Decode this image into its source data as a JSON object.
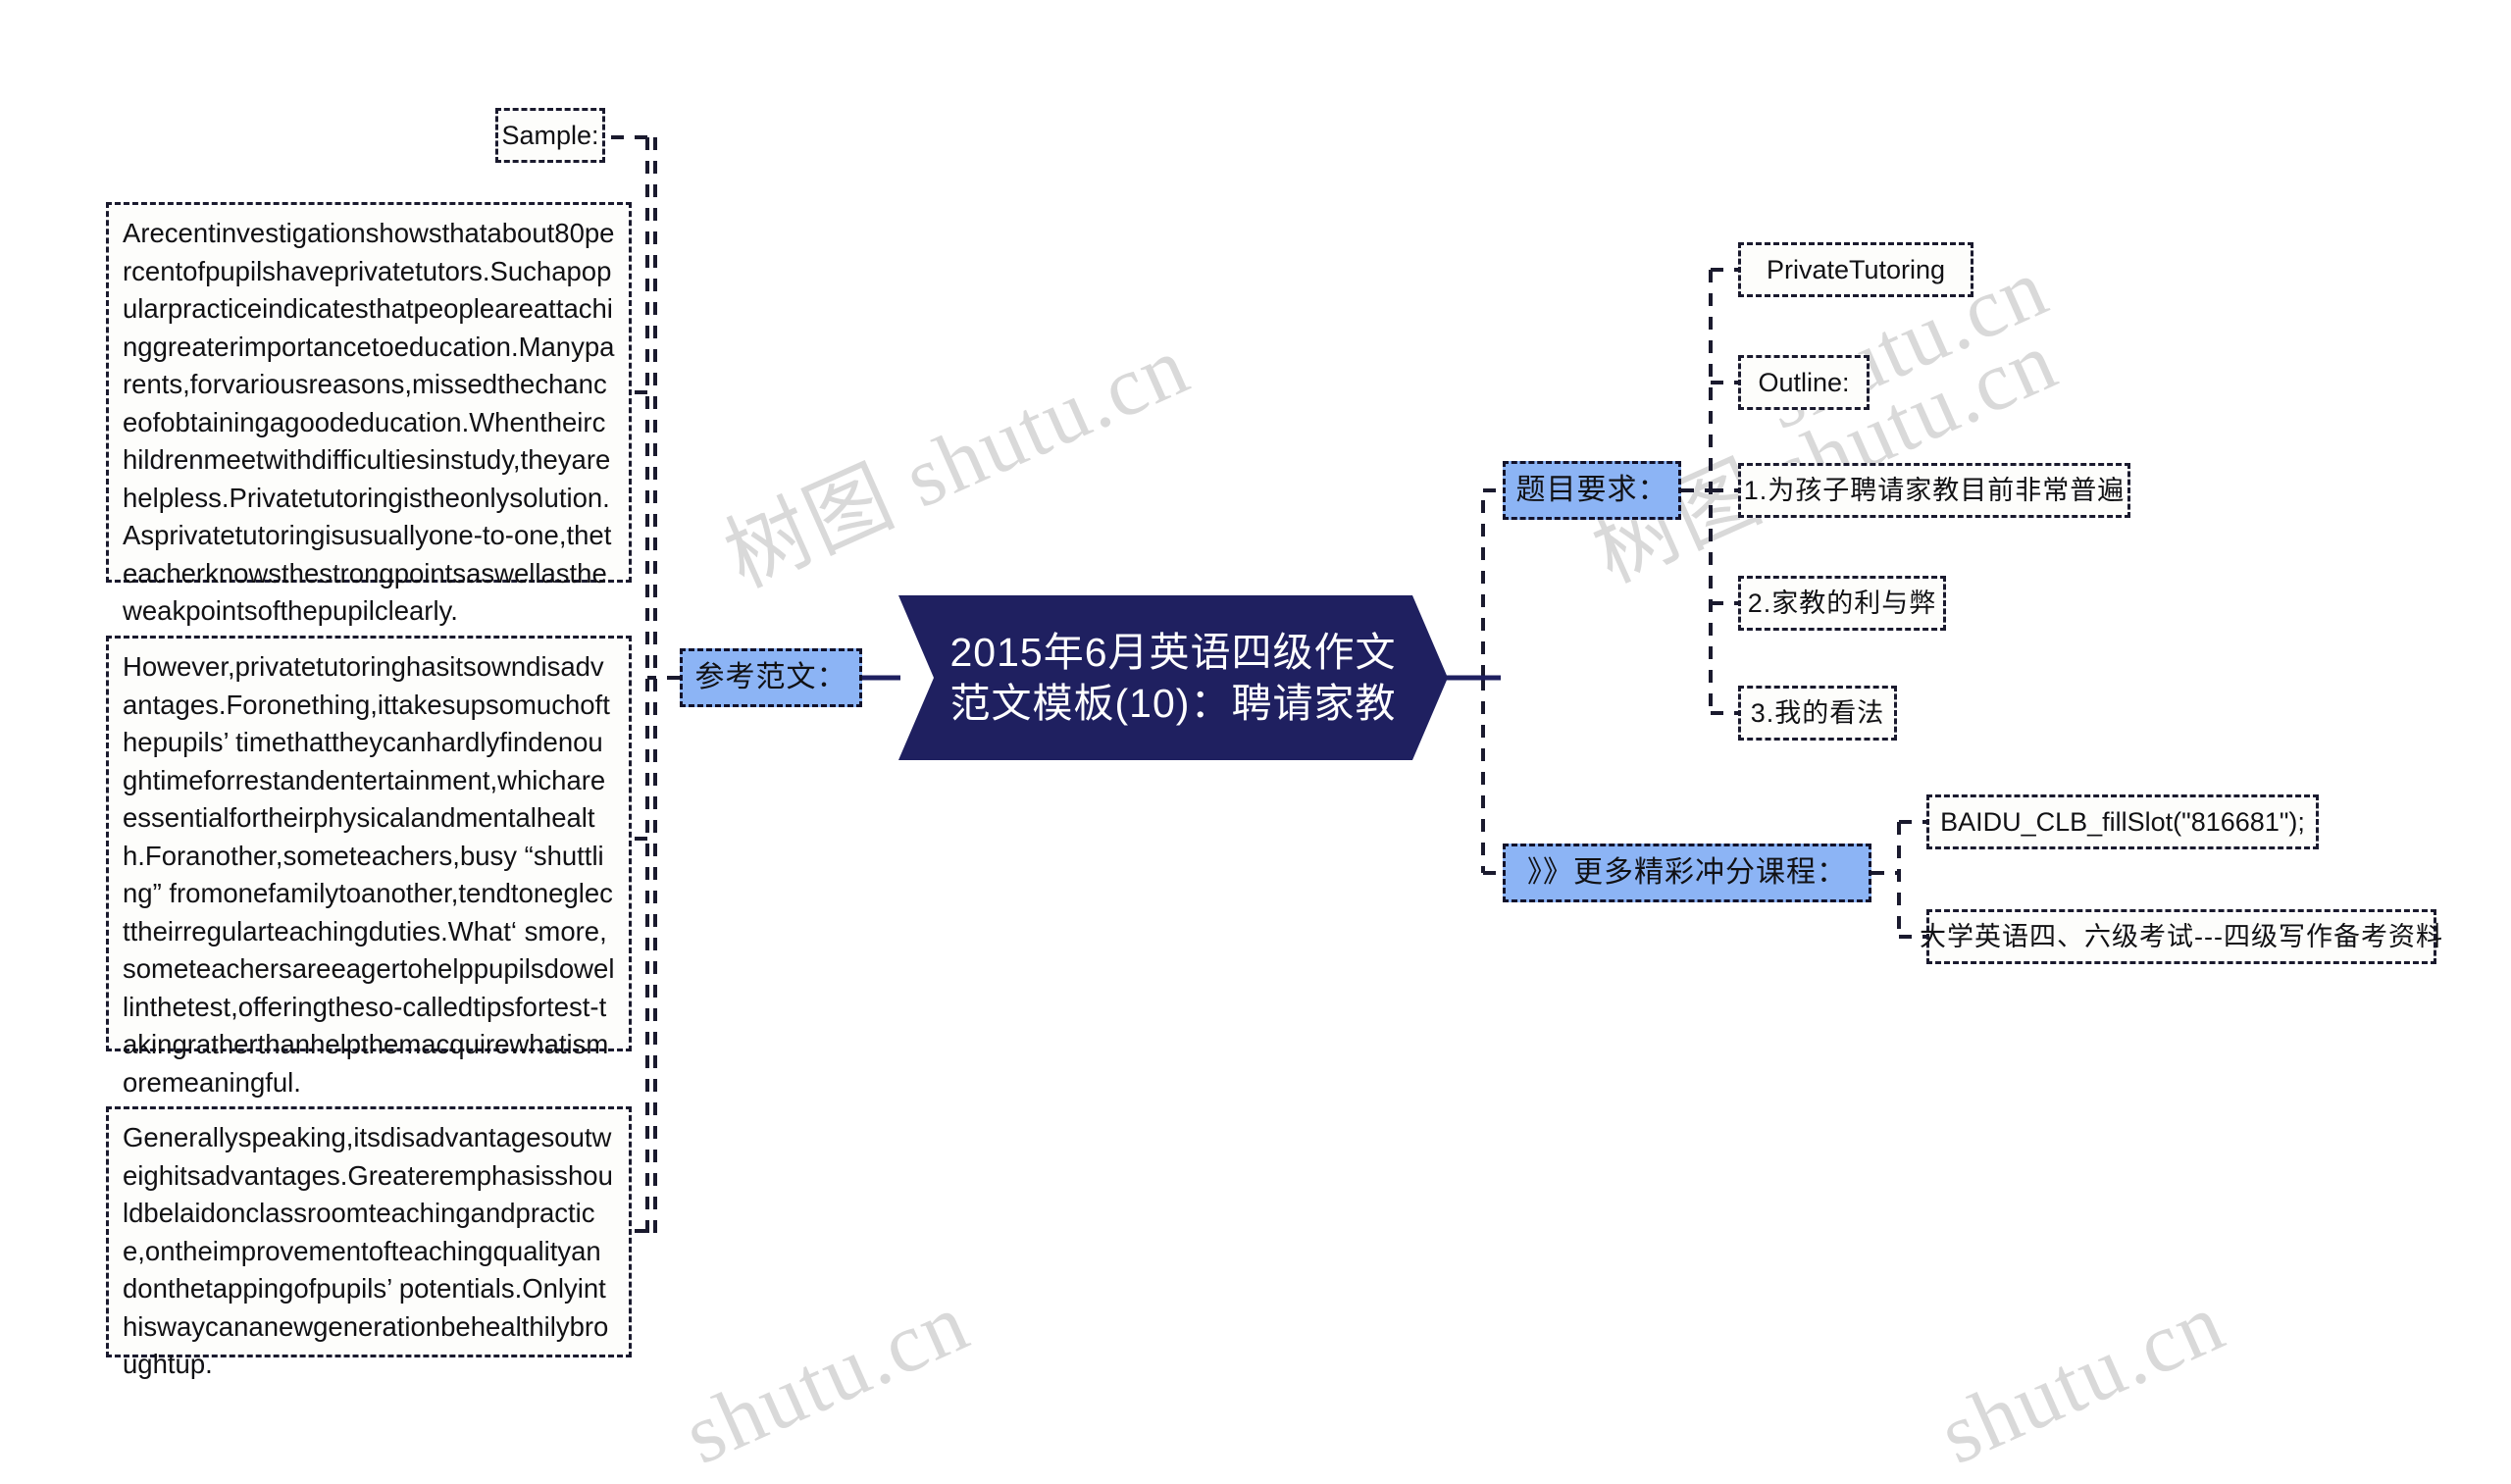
{
  "mindmap": {
    "center": {
      "line1": "2015年6月英语四级作文",
      "line2": "范文模板(10)：聘请家教",
      "fill": "#1f2060",
      "text_color": "#ffffff"
    },
    "branch_colors": {
      "highlight": "#8cb4f5",
      "node_border": "#1a1a2e",
      "node_fill": "#fdfdfb"
    },
    "left_branch": {
      "label": "参考范文：",
      "children": [
        {
          "label": "Sample:"
        },
        {
          "label": "Arecentinvestigationshowsthatabout80percentofpupilshaveprivatetutors.Suchapopularpracticeindicatesthatpeopleareattachinggreaterimportancetoeducation.Manyparents,forvariousreasons,missedthechanceofobtainingagoodeducation.Whentheirchildrenmeetwithdifficultiesinstudy,theyarehelpless.Privatetutoringistheonlysolution.Asprivatetutoringisusuallyone-to-one,theteacherknowsthestrongpointsaswellastheweakpointsofthepupilclearly."
        },
        {
          "label": "However,privatetutoringhasitsowndisadvantages.Foronething,ittakesupsomuchofthepupils’ timethattheycanhardlyfindenoughtimeforrestandentertainment,whichareessentialfortheirphysicalandmentalhealth.Foranother,someteachers,busy “shuttling” fromonefamilytoanother,tendtoneglecttheirregularteachingduties.What‘ smore,someteachersareeagertohelppupilsdowellinthetest,offeringtheso-calledtipsfortest-takingratherthanhelpthemacquirewhatismoremeaningful."
        },
        {
          "label": "Generallyspeaking,itsdisadvantagesoutweighitsadvantages.Greateremphasisshouldbelaidonclassroomteachingandpractice,ontheimprovementofteachingqualityandonthetappingofpupils’ potentials.Onlyinthiswaycananewgenerationbehealthilybroughtup."
        }
      ]
    },
    "right_branches": [
      {
        "label": "题目要求：",
        "children": [
          {
            "label": "PrivateTutoring"
          },
          {
            "label": "Outline:"
          },
          {
            "label": "1.为孩子聘请家教目前非常普遍"
          },
          {
            "label": "2.家教的利与弊"
          },
          {
            "label": "3.我的看法"
          }
        ]
      },
      {
        "label": "》》更多精彩冲分课程：",
        "children": [
          {
            "label": "BAIDU_CLB_fillSlot(\"816681\");"
          },
          {
            "label": "大学英语四、六级考试---四级写作备考资料"
          }
        ]
      }
    ]
  },
  "watermarks": [
    {
      "text": "树图 shutu.cn"
    },
    {
      "text": "树图 shutu.cn"
    },
    {
      "text": "shutu.cn"
    },
    {
      "text": "shutu.cn"
    },
    {
      "text": "shutu.cn"
    }
  ]
}
